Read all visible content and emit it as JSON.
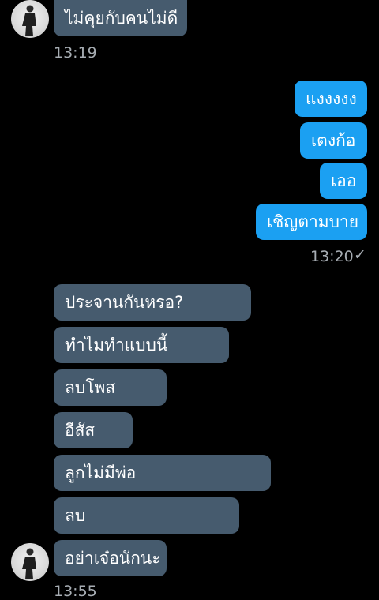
{
  "messages": [
    {
      "dir": "in",
      "text": "ไม่คุยกับคนไม่ดี"
    },
    {
      "dir": "out",
      "text": "แงงงงง"
    },
    {
      "dir": "out",
      "text": "เตงก้อ"
    },
    {
      "dir": "out",
      "text": "เออ"
    },
    {
      "dir": "out",
      "text": "เชิญตามบาย"
    },
    {
      "dir": "in",
      "text": "ประจานกันหรอ?"
    },
    {
      "dir": "in",
      "text": "ทำไมทำแบบนี้"
    },
    {
      "dir": "in",
      "text": "ลบโพส"
    },
    {
      "dir": "in",
      "text": "อีสัส"
    },
    {
      "dir": "in",
      "text": "ลูกไม่มีพ่อ"
    },
    {
      "dir": "in",
      "text": "ลบ"
    },
    {
      "dir": "in",
      "text": "อย่าเจ๋อนักนะ"
    }
  ],
  "timestamps": {
    "first_in": "13:19",
    "out": "13:20",
    "last_in": "13:55"
  },
  "read_receipt": "✓",
  "colors": {
    "incoming_bubble": "#465b6e",
    "outgoing_bubble": "#1ba0f2",
    "background": "#000000",
    "timestamp": "#a7adb3"
  }
}
